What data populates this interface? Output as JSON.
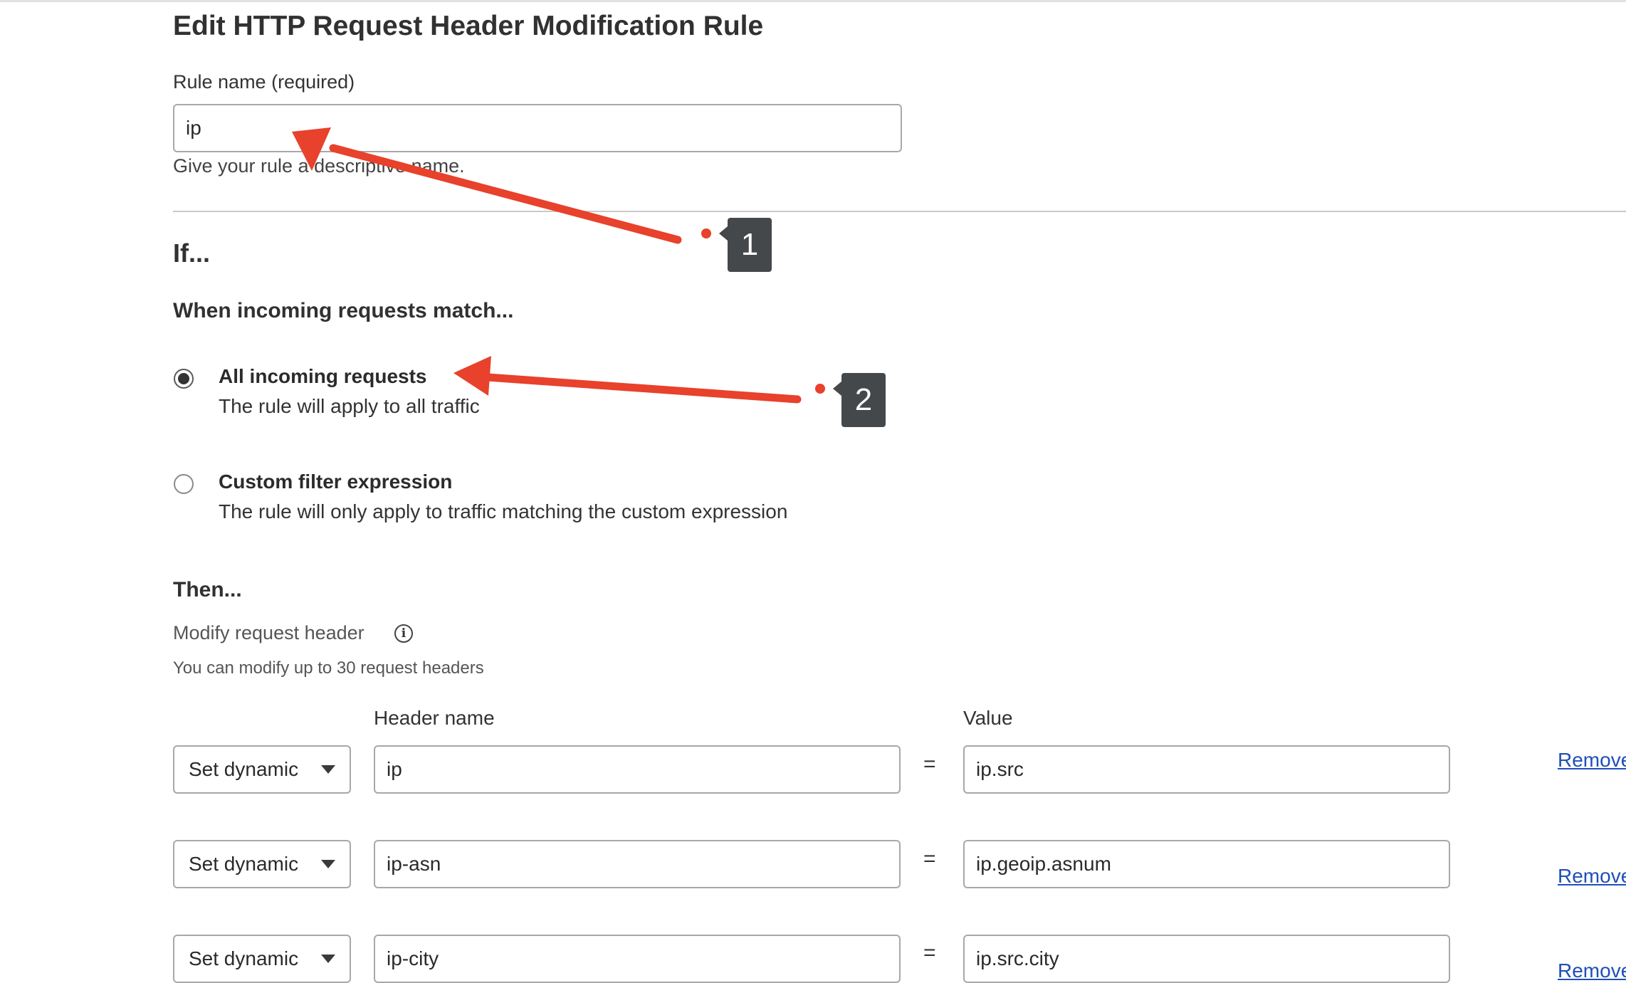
{
  "page": {
    "title": "Edit HTTP Request Header Modification Rule",
    "rule_name": {
      "label": "Rule name (required)",
      "value": "ip",
      "help": "Give your rule a descriptive name."
    },
    "if_heading": "If...",
    "match_heading": "When incoming requests match...",
    "options": [
      {
        "title": "All incoming requests",
        "description": "The rule will apply to all traffic",
        "selected": true
      },
      {
        "title": "Custom filter expression",
        "description": "The rule will only apply to traffic matching the custom expression",
        "selected": false
      }
    ],
    "then_heading": "Then...",
    "modify_label": "Modify request header",
    "modify_hint": "You can modify up to 30 request headers",
    "columns": {
      "header_name": "Header name",
      "value": "Value"
    },
    "equals": "=",
    "rows": [
      {
        "operation": "Set dynamic",
        "header": "ip",
        "value": "ip.src",
        "remove": "Remove"
      },
      {
        "operation": "Set dynamic",
        "header": "ip-asn",
        "value": "ip.geoip.asnum",
        "remove": "Remove"
      },
      {
        "operation": "Set dynamic",
        "header": "ip-city",
        "value": "ip.src.city",
        "remove": "Remove"
      }
    ]
  },
  "annotations": [
    {
      "number": "1",
      "color": "#e8412c"
    },
    {
      "number": "2",
      "color": "#e8412c"
    }
  ]
}
